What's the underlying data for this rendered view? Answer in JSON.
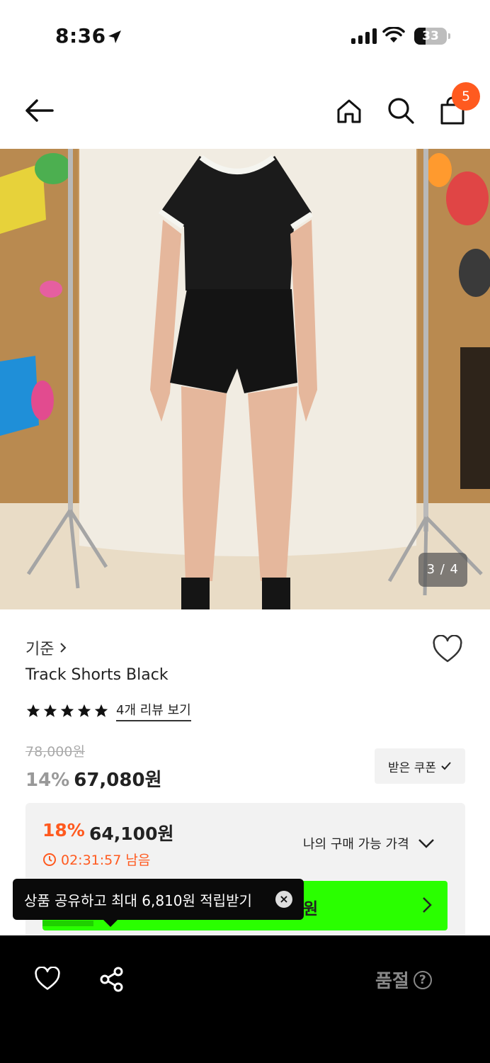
{
  "status": {
    "time": "8:36",
    "battery": "33"
  },
  "nav": {
    "cart_count": "5"
  },
  "gallery": {
    "counter": "3 / 4"
  },
  "product": {
    "brand": "기준",
    "name": "Track Shorts Black",
    "review_link": "4개 리뷰 보기",
    "rating_stars": 5,
    "original_price": "78,000원",
    "discount": "14%",
    "price": "67,080원",
    "coupon_label": "받은 쿠폰"
  },
  "special": {
    "discount": "18%",
    "price": "64,100원",
    "timer": "02:31:57 남음",
    "my_price_label": "나의 구매 가능 가격",
    "green_text": "0원"
  },
  "tooltip": {
    "text": "상품 공유하고 최대 6,810원 적립받기"
  },
  "bottom": {
    "soldout_label": "품절",
    "help_glyph": "?"
  },
  "colors": {
    "accent": "#ff5a1f",
    "green": "#2aff00",
    "bar": "#000000"
  }
}
